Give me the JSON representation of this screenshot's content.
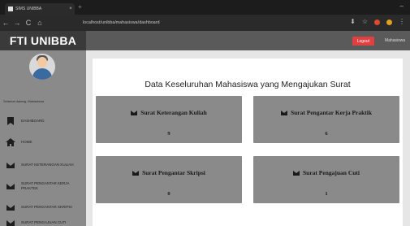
{
  "browser": {
    "tab_title": "SIMS UNIBBA",
    "url": "localhost/unibba/mahasiswa/dashboard",
    "nav_back": "←",
    "nav_forward": "→",
    "nav_reload": "C",
    "nav_home": "⌂",
    "win_ctrl": "–"
  },
  "sidebar": {
    "brand": "FTI UNIBBA",
    "user_line": "Selamat datang, Mahasiswa",
    "items": [
      {
        "label": "DASHBOARD",
        "icon": "bookmark-icon"
      },
      {
        "label": "HOME",
        "icon": "home-icon"
      },
      {
        "label": "SURAT KETERANGAN KULIAH",
        "icon": "envelope-icon"
      },
      {
        "label": "SURAT PENGANTAR KERJA PRAKTEK",
        "icon": "envelope-icon"
      },
      {
        "label": "SURAT PENGANTAR SKRIPSI",
        "icon": "envelope-icon"
      },
      {
        "label": "SURAT PENGAJUAN CUTI",
        "icon": "envelope-icon"
      }
    ]
  },
  "header": {
    "logout_label": "Logout",
    "user_label": "Mahasiswa"
  },
  "main": {
    "title": "Data Keseluruhan Mahasiswa yang Mengajukan Surat",
    "cards": [
      {
        "title": "Surat Keterangan Kuliah",
        "count": "9"
      },
      {
        "title": "Surat Pengantar Kerja Praktik",
        "count": "6"
      },
      {
        "title": "Surat Pengantar Skripsi",
        "count": "0"
      },
      {
        "title": "Surat Pengajuan Cuti",
        "count": "1"
      }
    ]
  },
  "colors": {
    "sidebar_dark": "#3a3a3a",
    "sidebar_body": "#8a8a8a",
    "card_bg": "#8a8a8a",
    "logout": "#e04040"
  }
}
